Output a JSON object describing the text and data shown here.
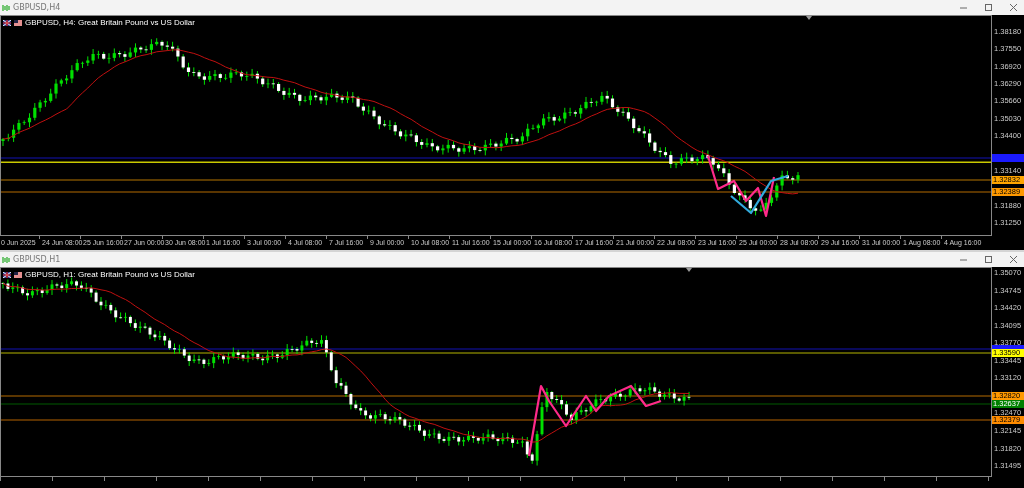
{
  "windows": [
    {
      "title": "GBPUSD,H4",
      "header": "GBPUSD, H4:  Great Britain Pound vs US Dollar",
      "price_ticks": [
        "1.38180",
        "1.37550",
        "1.36920",
        "1.36290",
        "1.35660",
        "1.35030",
        "1.34400",
        "1.33140",
        "1.31880",
        "1.31250"
      ],
      "price_lines": [
        {
          "kind": "tagged",
          "color": "#1a1aff"
        },
        {
          "kind": "line",
          "color": "#c8c800"
        },
        {
          "kind": "tagged",
          "color": "#ffa500",
          "tag": "1.32832"
        },
        {
          "kind": "tagged",
          "color": "#ff9900",
          "tag": "1.32389"
        }
      ],
      "time_labels": [
        "0 Jun 2025",
        "24 Jun 08:00",
        "25 Jun 16:00",
        "27 Jun 00:00",
        "30 Jun 08:00",
        "1 Jul 16:00",
        "3 Jul 00:00",
        "4 Jul 08:00",
        "7 Jul 16:00",
        "9 Jul 00:00",
        "10 Jul 08:00",
        "11 Jul 16:00",
        "15 Jul 00:00",
        "16 Jul 08:00",
        "17 Jul 16:00",
        "21 Jul 00:00",
        "22 Jul 08:00",
        "23 Jul 16:00",
        "25 Jul 00:00",
        "28 Jul 08:00",
        "29 Jul 16:00",
        "31 Jul 00:00",
        "1 Aug 08:00",
        "4 Aug 16:00"
      ]
    },
    {
      "title": "GBPUSD,H1",
      "header": "GBPUSD, H1:  Great Britain Pound vs US Dollar",
      "price_ticks": [
        "1.35070",
        "1.34745",
        "1.34420",
        "1.34095",
        "1.33770",
        "1.33445",
        "1.33120",
        "1.32470",
        "1.32145",
        "1.31820",
        "1.31495"
      ],
      "price_lines": [
        {
          "kind": "tagged",
          "color": "#1a1aff"
        },
        {
          "kind": "tagged",
          "color": "#ffff00",
          "tag": "1.33590"
        },
        {
          "kind": "tagged",
          "color": "#ff9900",
          "tag": "1.32820"
        },
        {
          "kind": "tagged",
          "color": "#008000",
          "tag": "1.32637"
        },
        {
          "kind": "tagged",
          "color": "#ff8c00",
          "tag": "1.32379"
        }
      ]
    }
  ]
}
